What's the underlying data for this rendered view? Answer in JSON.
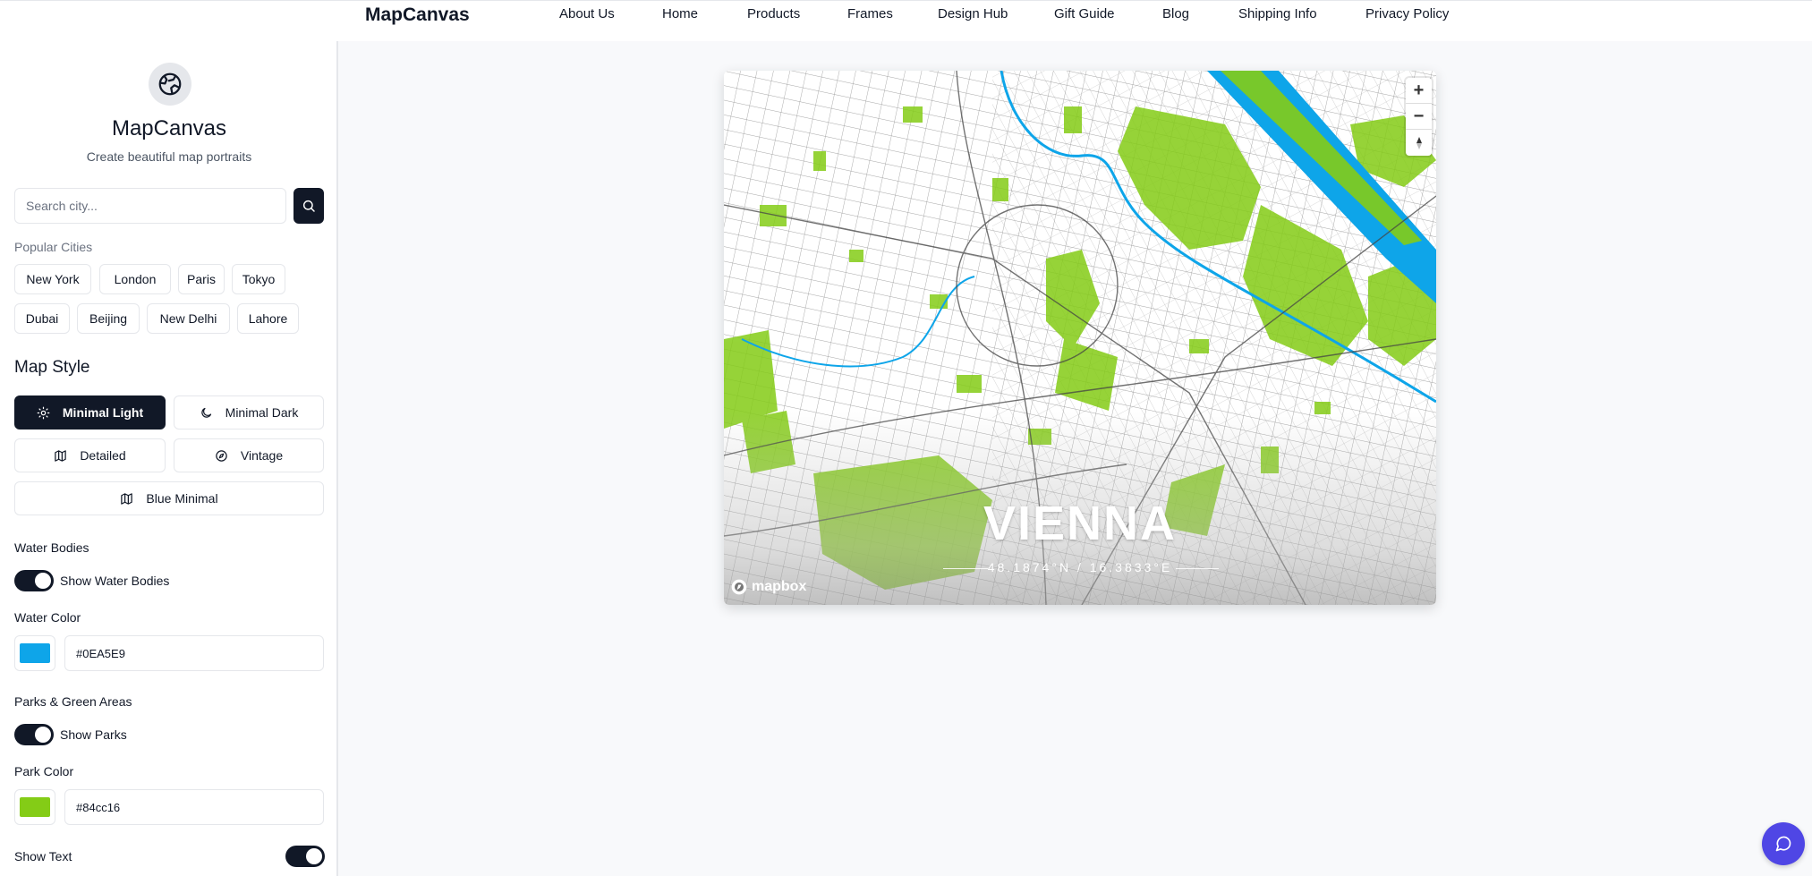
{
  "header": {
    "brand": "MapCanvas",
    "nav": [
      "About Us",
      "Home",
      "Products",
      "Frames",
      "Design Hub",
      "Gift Guide",
      "Blog",
      "Shipping Info",
      "Privacy Policy"
    ]
  },
  "sidebar": {
    "logo_icon": "globe-icon",
    "title": "MapCanvas",
    "subtitle": "Create beautiful map portraits",
    "search": {
      "placeholder": "Search city...",
      "value": ""
    },
    "popular_label": "Popular Cities",
    "popular_cities": [
      "New York",
      "London",
      "Paris",
      "Tokyo",
      "Dubai",
      "Beijing",
      "New Delhi",
      "Lahore"
    ],
    "map_style_heading": "Map Style",
    "map_styles": [
      {
        "label": "Minimal Light",
        "icon": "sun-icon",
        "active": true
      },
      {
        "label": "Minimal Dark",
        "icon": "moon-icon",
        "active": false
      },
      {
        "label": "Detailed",
        "icon": "map-icon",
        "active": false
      },
      {
        "label": "Vintage",
        "icon": "compass-icon",
        "active": false
      },
      {
        "label": "Blue Minimal",
        "icon": "map-icon",
        "active": false
      }
    ],
    "water": {
      "section": "Water Bodies",
      "toggle_label": "Show Water Bodies",
      "enabled": true,
      "color_label": "Water Color",
      "color": "#0EA5E9"
    },
    "parks": {
      "section": "Parks & Green Areas",
      "toggle_label": "Show Parks",
      "enabled": true,
      "color_label": "Park Color",
      "color": "#84cc16"
    },
    "text": {
      "toggle_label": "Show Text",
      "enabled": true
    }
  },
  "map": {
    "city": "VIENNA",
    "coordinates": "48.1874°N / 16.3833°E",
    "attribution": "mapbox",
    "zoom_in": "+",
    "zoom_out": "−",
    "colors": {
      "water": "#0EA5E9",
      "park": "#84cc16",
      "street": "#555555",
      "land": "#ffffff"
    }
  },
  "chat": {
    "icon": "chat-icon"
  }
}
